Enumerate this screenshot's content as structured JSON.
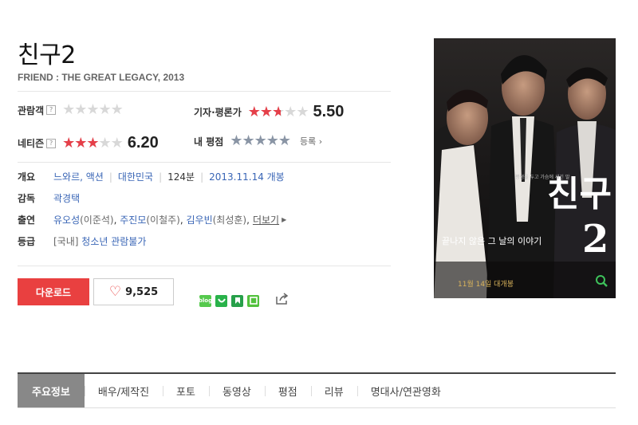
{
  "movie": {
    "title": "친구2",
    "subtitle": "FRIEND : THE GREAT LEGACY, 2013"
  },
  "ratings": {
    "audience_label": "관람객",
    "audience_stars_fraction": 0,
    "critic_label": "기자·평론가",
    "critic_score": "5.50",
    "critic_stars_fraction": 0.55,
    "netizen_label": "네티즌",
    "netizen_score": "6.20",
    "netizen_stars_fraction": 0.62,
    "my_label": "내 평점",
    "my_stars_fraction": 0,
    "register_label": "등록",
    "help_glyph": "?"
  },
  "info": {
    "overview_label": "개요",
    "genres": [
      "느와르",
      "액션"
    ],
    "country": "대한민국",
    "runtime": "124분",
    "release": "2013.11.14 개봉",
    "director_label": "감독",
    "director": "곽경택",
    "cast_label": "출연",
    "cast": [
      {
        "actor": "유오성",
        "role": "(이준석)"
      },
      {
        "actor": "주진모",
        "role": "(이철주)"
      },
      {
        "actor": "김우빈",
        "role": "(최성훈)"
      }
    ],
    "more_label": "더보기",
    "rating_label": "등급",
    "rating_region": "[국내]",
    "rating_value": "청소년 관람불가"
  },
  "actions": {
    "download_label": "다운로드",
    "like_count": "9,525"
  },
  "share": {
    "icons": [
      "blog-icon",
      "cafe-icon",
      "bookmark-icon",
      "memo-icon"
    ],
    "colors": [
      "#55c94d",
      "#29b24a",
      "#27a04a",
      "#53c13d"
    ],
    "blog_text": "blog"
  },
  "poster": {
    "title_text": "친구",
    "number_text": "2",
    "tagline": "끝나지 않은 그 날의 이야기",
    "date_text": "11월 14일 대개봉",
    "top_text": "평생을 두고 가슴에 새긴 말"
  },
  "tabs": [
    "주요정보",
    "배우/제작진",
    "포토",
    "동영상",
    "평점",
    "리뷰",
    "명대사/연관영화"
  ]
}
